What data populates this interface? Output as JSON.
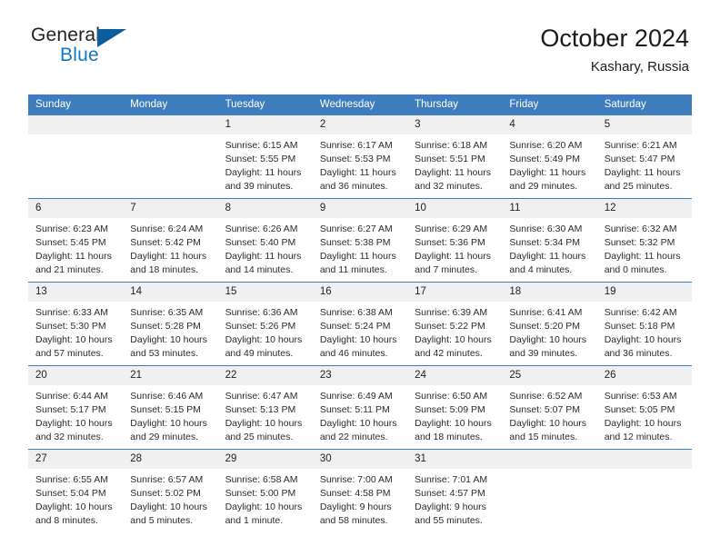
{
  "logo": {
    "word_one": "General",
    "word_two": "Blue",
    "triangle_color": "#0d5d9e"
  },
  "header": {
    "title": "October 2024",
    "subtitle": "Kashary, Russia",
    "accent_color": "#3d7cbd",
    "daynum_band_color": "#f0f0f0"
  },
  "weekday_headers": [
    "Sunday",
    "Monday",
    "Tuesday",
    "Wednesday",
    "Thursday",
    "Friday",
    "Saturday"
  ],
  "weeks": [
    [
      {
        "day": "",
        "lines": []
      },
      {
        "day": "",
        "lines": []
      },
      {
        "day": "1",
        "lines": [
          "Sunrise: 6:15 AM",
          "Sunset: 5:55 PM",
          "Daylight: 11 hours",
          "and 39 minutes."
        ]
      },
      {
        "day": "2",
        "lines": [
          "Sunrise: 6:17 AM",
          "Sunset: 5:53 PM",
          "Daylight: 11 hours",
          "and 36 minutes."
        ]
      },
      {
        "day": "3",
        "lines": [
          "Sunrise: 6:18 AM",
          "Sunset: 5:51 PM",
          "Daylight: 11 hours",
          "and 32 minutes."
        ]
      },
      {
        "day": "4",
        "lines": [
          "Sunrise: 6:20 AM",
          "Sunset: 5:49 PM",
          "Daylight: 11 hours",
          "and 29 minutes."
        ]
      },
      {
        "day": "5",
        "lines": [
          "Sunrise: 6:21 AM",
          "Sunset: 5:47 PM",
          "Daylight: 11 hours",
          "and 25 minutes."
        ]
      }
    ],
    [
      {
        "day": "6",
        "lines": [
          "Sunrise: 6:23 AM",
          "Sunset: 5:45 PM",
          "Daylight: 11 hours",
          "and 21 minutes."
        ]
      },
      {
        "day": "7",
        "lines": [
          "Sunrise: 6:24 AM",
          "Sunset: 5:42 PM",
          "Daylight: 11 hours",
          "and 18 minutes."
        ]
      },
      {
        "day": "8",
        "lines": [
          "Sunrise: 6:26 AM",
          "Sunset: 5:40 PM",
          "Daylight: 11 hours",
          "and 14 minutes."
        ]
      },
      {
        "day": "9",
        "lines": [
          "Sunrise: 6:27 AM",
          "Sunset: 5:38 PM",
          "Daylight: 11 hours",
          "and 11 minutes."
        ]
      },
      {
        "day": "10",
        "lines": [
          "Sunrise: 6:29 AM",
          "Sunset: 5:36 PM",
          "Daylight: 11 hours",
          "and 7 minutes."
        ]
      },
      {
        "day": "11",
        "lines": [
          "Sunrise: 6:30 AM",
          "Sunset: 5:34 PM",
          "Daylight: 11 hours",
          "and 4 minutes."
        ]
      },
      {
        "day": "12",
        "lines": [
          "Sunrise: 6:32 AM",
          "Sunset: 5:32 PM",
          "Daylight: 11 hours",
          "and 0 minutes."
        ]
      }
    ],
    [
      {
        "day": "13",
        "lines": [
          "Sunrise: 6:33 AM",
          "Sunset: 5:30 PM",
          "Daylight: 10 hours",
          "and 57 minutes."
        ]
      },
      {
        "day": "14",
        "lines": [
          "Sunrise: 6:35 AM",
          "Sunset: 5:28 PM",
          "Daylight: 10 hours",
          "and 53 minutes."
        ]
      },
      {
        "day": "15",
        "lines": [
          "Sunrise: 6:36 AM",
          "Sunset: 5:26 PM",
          "Daylight: 10 hours",
          "and 49 minutes."
        ]
      },
      {
        "day": "16",
        "lines": [
          "Sunrise: 6:38 AM",
          "Sunset: 5:24 PM",
          "Daylight: 10 hours",
          "and 46 minutes."
        ]
      },
      {
        "day": "17",
        "lines": [
          "Sunrise: 6:39 AM",
          "Sunset: 5:22 PM",
          "Daylight: 10 hours",
          "and 42 minutes."
        ]
      },
      {
        "day": "18",
        "lines": [
          "Sunrise: 6:41 AM",
          "Sunset: 5:20 PM",
          "Daylight: 10 hours",
          "and 39 minutes."
        ]
      },
      {
        "day": "19",
        "lines": [
          "Sunrise: 6:42 AM",
          "Sunset: 5:18 PM",
          "Daylight: 10 hours",
          "and 36 minutes."
        ]
      }
    ],
    [
      {
        "day": "20",
        "lines": [
          "Sunrise: 6:44 AM",
          "Sunset: 5:17 PM",
          "Daylight: 10 hours",
          "and 32 minutes."
        ]
      },
      {
        "day": "21",
        "lines": [
          "Sunrise: 6:46 AM",
          "Sunset: 5:15 PM",
          "Daylight: 10 hours",
          "and 29 minutes."
        ]
      },
      {
        "day": "22",
        "lines": [
          "Sunrise: 6:47 AM",
          "Sunset: 5:13 PM",
          "Daylight: 10 hours",
          "and 25 minutes."
        ]
      },
      {
        "day": "23",
        "lines": [
          "Sunrise: 6:49 AM",
          "Sunset: 5:11 PM",
          "Daylight: 10 hours",
          "and 22 minutes."
        ]
      },
      {
        "day": "24",
        "lines": [
          "Sunrise: 6:50 AM",
          "Sunset: 5:09 PM",
          "Daylight: 10 hours",
          "and 18 minutes."
        ]
      },
      {
        "day": "25",
        "lines": [
          "Sunrise: 6:52 AM",
          "Sunset: 5:07 PM",
          "Daylight: 10 hours",
          "and 15 minutes."
        ]
      },
      {
        "day": "26",
        "lines": [
          "Sunrise: 6:53 AM",
          "Sunset: 5:05 PM",
          "Daylight: 10 hours",
          "and 12 minutes."
        ]
      }
    ],
    [
      {
        "day": "27",
        "lines": [
          "Sunrise: 6:55 AM",
          "Sunset: 5:04 PM",
          "Daylight: 10 hours",
          "and 8 minutes."
        ]
      },
      {
        "day": "28",
        "lines": [
          "Sunrise: 6:57 AM",
          "Sunset: 5:02 PM",
          "Daylight: 10 hours",
          "and 5 minutes."
        ]
      },
      {
        "day": "29",
        "lines": [
          "Sunrise: 6:58 AM",
          "Sunset: 5:00 PM",
          "Daylight: 10 hours",
          "and 1 minute."
        ]
      },
      {
        "day": "30",
        "lines": [
          "Sunrise: 7:00 AM",
          "Sunset: 4:58 PM",
          "Daylight: 9 hours",
          "and 58 minutes."
        ]
      },
      {
        "day": "31",
        "lines": [
          "Sunrise: 7:01 AM",
          "Sunset: 4:57 PM",
          "Daylight: 9 hours",
          "and 55 minutes."
        ]
      },
      {
        "day": "",
        "lines": []
      },
      {
        "day": "",
        "lines": []
      }
    ]
  ]
}
